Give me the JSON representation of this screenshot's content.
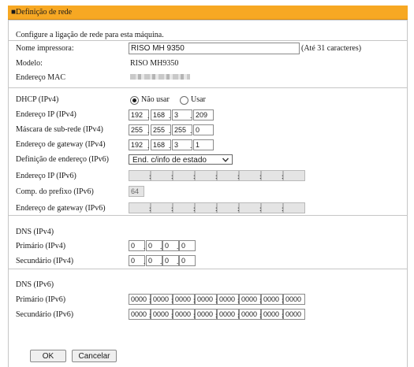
{
  "header": {
    "title": "■Definição de rede"
  },
  "intro": "Configure a ligação de rede para esta máquina.",
  "printer": {
    "name_label": "Nome impressora:",
    "name_value": "RISO MH 9350",
    "name_hint": "(Até 31 caracteres)",
    "model_label": "Modelo:",
    "model_value": "RISO MH9350",
    "mac_label": "Endereço MAC"
  },
  "ipv4": {
    "dhcp_label": "DHCP (IPv4)",
    "dhcp_options": [
      "Não usar",
      "Usar"
    ],
    "dhcp_selected": "Não usar",
    "ip_label": "Endereço IP (IPv4)",
    "ip": [
      "192",
      "168",
      "3",
      "209"
    ],
    "mask_label": "Máscara de sub-rede (IPv4)",
    "mask": [
      "255",
      "255",
      "255",
      "0"
    ],
    "gateway_label": "Endereço de gateway (IPv4)",
    "gateway": [
      "192",
      "168",
      "3",
      "1"
    ]
  },
  "ipv6": {
    "def_label": "Definição de endereço (IPv6)",
    "def_value": "End. c/info de estado",
    "ip_label": "Endereço IP (IPv6)",
    "prefix_label": "Comp. do prefixo (IPv6)",
    "prefix_value": "64",
    "gateway_label": "Endereço de gateway (IPv6)"
  },
  "dns4": {
    "title": "DNS (IPv4)",
    "primary_label": "Primário (IPv4)",
    "primary": [
      "0",
      "0",
      "0",
      "0"
    ],
    "secondary_label": "Secundário (IPv4)",
    "secondary": [
      "0",
      "0",
      "0",
      "0"
    ]
  },
  "dns6": {
    "title": "DNS (IPv6)",
    "primary_label": "Primário (IPv6)",
    "primary": [
      "0000",
      "0000",
      "0000",
      "0000",
      "0000",
      "0000",
      "0000",
      "0000"
    ],
    "secondary_label": "Secundário (IPv6)",
    "secondary": [
      "0000",
      "0000",
      "0000",
      "0000",
      "0000",
      "0000",
      "0000",
      "0000"
    ]
  },
  "buttons": {
    "ok": "OK",
    "cancel": "Cancelar"
  },
  "colors": {
    "header": "#f7a823",
    "border": "#c6c6c6"
  }
}
